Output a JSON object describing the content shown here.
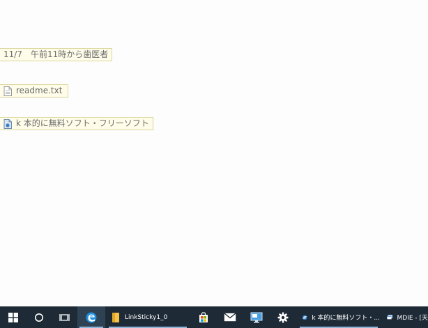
{
  "stickies": [
    {
      "label": "11/7　午前11時から歯医者",
      "icon": "none"
    },
    {
      "label": "readme.txt",
      "icon": "text-file-icon"
    },
    {
      "label": "k 本的に無料ソフト・フリーソフト",
      "icon": "web-document-icon"
    }
  ],
  "taskbar": {
    "pinned": [
      {
        "name": "start-button",
        "icon": "windows-logo-icon"
      },
      {
        "name": "search-button",
        "icon": "circle-icon"
      },
      {
        "name": "task-view-button",
        "icon": "task-view-icon"
      },
      {
        "name": "edge-button",
        "icon": "edge-icon"
      }
    ],
    "tasks": [
      {
        "label": "LinkSticky1_0",
        "icon": "folder-icon"
      },
      {
        "label": "k 本的に無料ソフト・...",
        "icon": "browser-icon"
      },
      {
        "label": "MDIE - [天",
        "icon": "app-window-icon"
      }
    ],
    "colors": {
      "background": "#1e2a36",
      "active": "#2f4254",
      "accent": "#8fb5d8"
    }
  },
  "colors": {
    "sticky_bg": "#fffde9",
    "sticky_border": "#d9d59c",
    "sticky_text": "#6b6b6b"
  }
}
